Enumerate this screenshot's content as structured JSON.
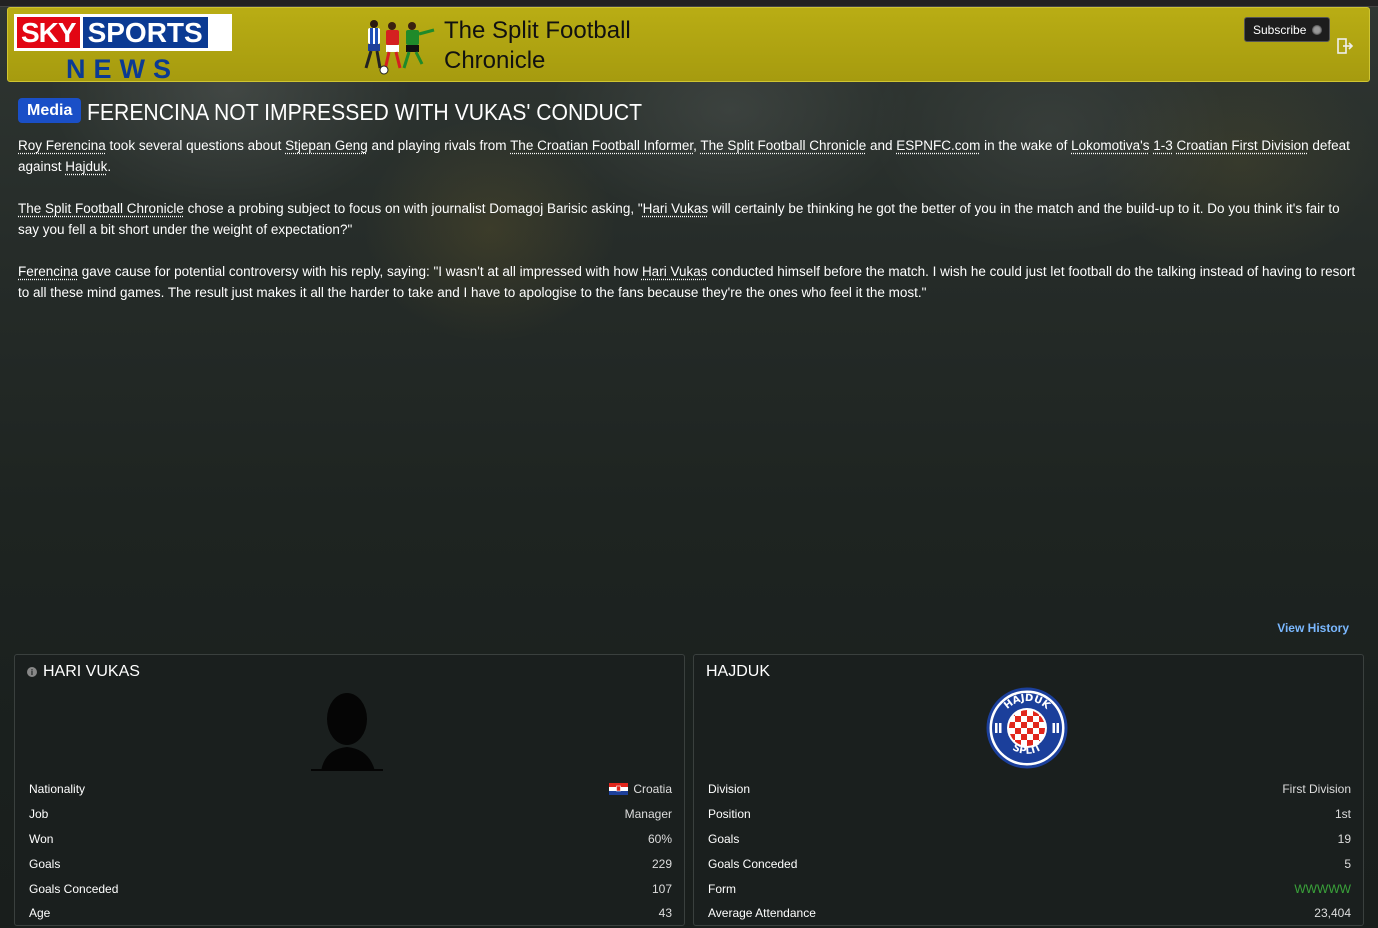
{
  "header": {
    "brand_top_red": "SKY",
    "brand_top_blue": "SPORTS",
    "brand_bottom": "NEWS",
    "paper_title_line1": "The Split Football",
    "paper_title_line2": "Chronicle",
    "subscribe_label": "Subscribe"
  },
  "article": {
    "badge": "Media",
    "headline": "FERENCINA NOT IMPRESSED WITH VUKAS' CONDUCT",
    "p1": [
      {
        "t": "Roy Ferencina",
        "link": true
      },
      {
        "t": " took several questions about ",
        "link": false
      },
      {
        "t": "Stjepan Geng",
        "link": true
      },
      {
        "t": " and playing rivals from ",
        "link": false
      },
      {
        "t": "The Croatian Football Informer",
        "link": true
      },
      {
        "t": ", ",
        "link": false
      },
      {
        "t": "The Split Football Chronicle",
        "link": true
      },
      {
        "t": " and ",
        "link": false
      },
      {
        "t": "ESPNFC.com",
        "link": true
      },
      {
        "t": " in the wake of ",
        "link": false
      },
      {
        "t": "Lokomotiva's",
        "link": true
      },
      {
        "t": " ",
        "link": false
      },
      {
        "t": "1-3",
        "link": true
      },
      {
        "t": " ",
        "link": false
      },
      {
        "t": "Croatian First Division",
        "link": true
      },
      {
        "t": " defeat against ",
        "link": false
      },
      {
        "t": "Hajduk",
        "link": true
      },
      {
        "t": ".",
        "link": false
      }
    ],
    "p2": [
      {
        "t": "The Split Football Chronicle",
        "link": true
      },
      {
        "t": " chose a probing subject to focus on with journalist Domagoj Barisic asking, \"",
        "link": false
      },
      {
        "t": "Hari Vukas",
        "link": true
      },
      {
        "t": " will certainly be thinking he got the better of you in the match and the build-up to it. Do you think it's fair to say you fell a bit short under the weight of expectation?\"",
        "link": false
      }
    ],
    "p3": [
      {
        "t": "Ferencina",
        "link": true
      },
      {
        "t": " gave cause for potential controversy with his reply, saying: \"I wasn't at all impressed with how ",
        "link": false
      },
      {
        "t": "Hari Vukas",
        "link": true
      },
      {
        "t": " conducted himself before the match. I wish he could just let football do the talking instead of having to resort to all these mind games. The result just makes it all the harder to take and I have to apologise to the fans because they're the ones who feel it the most.\"",
        "link": false
      }
    ],
    "view_history": "View History"
  },
  "person_card": {
    "title": "HARI VUKAS",
    "rows": [
      {
        "label": "Nationality",
        "value": "Croatia"
      },
      {
        "label": "Job",
        "value": "Manager"
      },
      {
        "label": "Won",
        "value": "60%"
      },
      {
        "label": "Goals",
        "value": "229"
      },
      {
        "label": "Goals Conceded",
        "value": "107"
      },
      {
        "label": "Age",
        "value": "43"
      }
    ]
  },
  "club_card": {
    "title": "HAJDUK",
    "crest_top": "HAJDUK",
    "crest_bottom": "SPLIT",
    "rows": [
      {
        "label": "Division",
        "value": "First Division"
      },
      {
        "label": "Position",
        "value": "1st"
      },
      {
        "label": "Goals",
        "value": "19"
      },
      {
        "label": "Goals Conceded",
        "value": "5"
      },
      {
        "label": "Form",
        "value": "WWWWW"
      },
      {
        "label": "Average Attendance",
        "value": "23,404"
      }
    ]
  },
  "colors": {
    "header_bg": "#b0a512",
    "badge_bg": "#1a4fc7",
    "link_accent": "#7ab8ff",
    "form_green": "#3aa43a"
  }
}
